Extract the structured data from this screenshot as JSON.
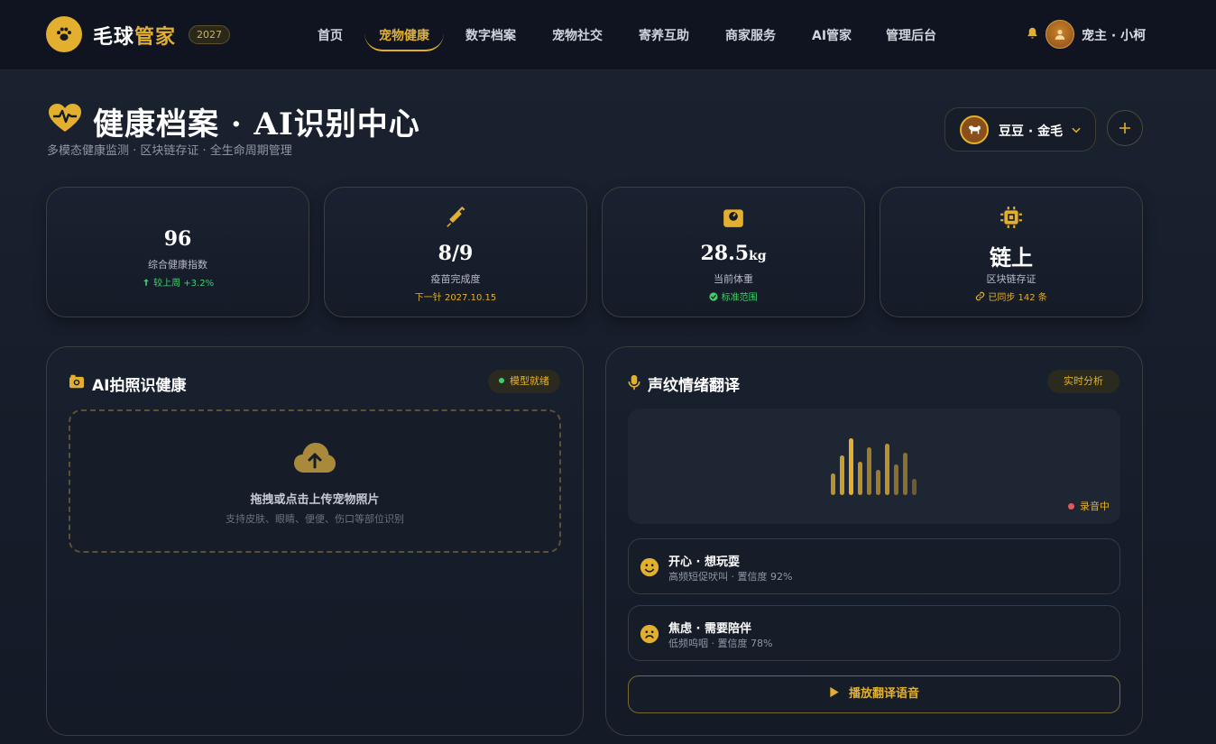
{
  "nav": {
    "logo_part1": "毛球",
    "logo_part2": "管家",
    "year": "2027",
    "items": [
      {
        "label": "首页"
      },
      {
        "label": "宠物健康"
      },
      {
        "label": "数字档案"
      },
      {
        "label": "宠物社交"
      },
      {
        "label": "寄养互助"
      },
      {
        "label": "商家服务"
      },
      {
        "label": "AI管家"
      },
      {
        "label": "管理后台"
      }
    ],
    "active_item": "宠物健康",
    "user": "宠主 · 小柯"
  },
  "header": {
    "title": "健康档案 · AI识别中心",
    "subtitle": "多模态健康监测 · 区块链存证 · 全生命周期管理",
    "pet_select": "豆豆 · 金毛"
  },
  "stats": [
    {
      "value": "96",
      "unit": "",
      "label": "综合健康指数",
      "sub": "较上周 +3.2%",
      "sub_color": "#3fcf6a",
      "icon": "heart-icon"
    },
    {
      "value": "8/9",
      "unit": "",
      "label": "疫苗完成度",
      "sub": "下一针 2027.10.15",
      "sub_color": "#e2b02e",
      "icon": "syringe-icon"
    },
    {
      "value": "28.5",
      "unit": "kg",
      "label": "当前体重",
      "sub": "标准范围",
      "sub_color": "#3fcf6a",
      "icon": "weight-scale-icon"
    },
    {
      "value": "链上",
      "unit": "",
      "label": "区块链存证",
      "sub": "已同步 142 条",
      "sub_color": "#e2b02e",
      "icon": "chip-icon"
    }
  ],
  "photo_panel": {
    "title": "AI拍照识健康",
    "status": "模型就绪",
    "drop_main": "拖拽或点击上传宠物照片",
    "drop_sub": "支持皮肤、眼睛、便便、伤口等部位识别"
  },
  "voice_panel": {
    "title": "声纹情绪翻译",
    "status": "实时分析",
    "recording": "录音中",
    "emotions": [
      {
        "title": "开心 · 想玩耍",
        "detail": "高频短促吠叫 · 置信度 92%",
        "icon": "happy-face-icon"
      },
      {
        "title": "焦虑 · 需要陪伴",
        "detail": "低频呜咽 · 置信度 78%",
        "icon": "sad-face-icon"
      }
    ],
    "play_label": "播放翻译语音"
  },
  "colors": {
    "accent": "#e2b02e",
    "success": "#3fcf6a",
    "recording": "#e05a5a"
  }
}
